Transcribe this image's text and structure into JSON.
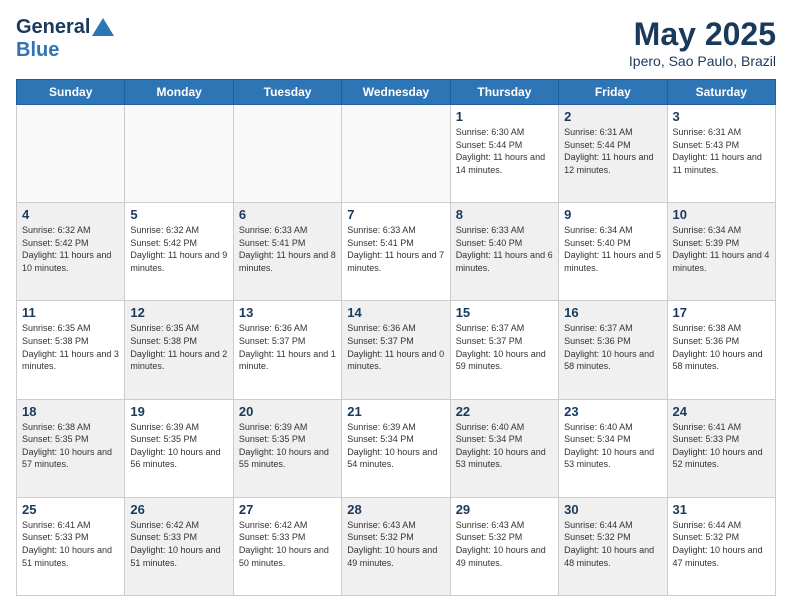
{
  "header": {
    "logo_line1": "General",
    "logo_line2": "Blue",
    "month": "May 2025",
    "location": "Ipero, Sao Paulo, Brazil"
  },
  "days_of_week": [
    "Sunday",
    "Monday",
    "Tuesday",
    "Wednesday",
    "Thursday",
    "Friday",
    "Saturday"
  ],
  "weeks": [
    [
      {
        "day": "",
        "empty": true
      },
      {
        "day": "",
        "empty": true
      },
      {
        "day": "",
        "empty": true
      },
      {
        "day": "",
        "empty": true
      },
      {
        "day": "1",
        "sunrise": "6:30 AM",
        "sunset": "5:44 PM",
        "daylight": "11 hours and 14 minutes."
      },
      {
        "day": "2",
        "sunrise": "6:31 AM",
        "sunset": "5:44 PM",
        "daylight": "11 hours and 12 minutes."
      },
      {
        "day": "3",
        "sunrise": "6:31 AM",
        "sunset": "5:43 PM",
        "daylight": "11 hours and 11 minutes."
      }
    ],
    [
      {
        "day": "4",
        "sunrise": "6:32 AM",
        "sunset": "5:42 PM",
        "daylight": "11 hours and 10 minutes."
      },
      {
        "day": "5",
        "sunrise": "6:32 AM",
        "sunset": "5:42 PM",
        "daylight": "11 hours and 9 minutes."
      },
      {
        "day": "6",
        "sunrise": "6:33 AM",
        "sunset": "5:41 PM",
        "daylight": "11 hours and 8 minutes."
      },
      {
        "day": "7",
        "sunrise": "6:33 AM",
        "sunset": "5:41 PM",
        "daylight": "11 hours and 7 minutes."
      },
      {
        "day": "8",
        "sunrise": "6:33 AM",
        "sunset": "5:40 PM",
        "daylight": "11 hours and 6 minutes."
      },
      {
        "day": "9",
        "sunrise": "6:34 AM",
        "sunset": "5:40 PM",
        "daylight": "11 hours and 5 minutes."
      },
      {
        "day": "10",
        "sunrise": "6:34 AM",
        "sunset": "5:39 PM",
        "daylight": "11 hours and 4 minutes."
      }
    ],
    [
      {
        "day": "11",
        "sunrise": "6:35 AM",
        "sunset": "5:38 PM",
        "daylight": "11 hours and 3 minutes."
      },
      {
        "day": "12",
        "sunrise": "6:35 AM",
        "sunset": "5:38 PM",
        "daylight": "11 hours and 2 minutes."
      },
      {
        "day": "13",
        "sunrise": "6:36 AM",
        "sunset": "5:37 PM",
        "daylight": "11 hours and 1 minute."
      },
      {
        "day": "14",
        "sunrise": "6:36 AM",
        "sunset": "5:37 PM",
        "daylight": "11 hours and 0 minutes."
      },
      {
        "day": "15",
        "sunrise": "6:37 AM",
        "sunset": "5:37 PM",
        "daylight": "10 hours and 59 minutes."
      },
      {
        "day": "16",
        "sunrise": "6:37 AM",
        "sunset": "5:36 PM",
        "daylight": "10 hours and 58 minutes."
      },
      {
        "day": "17",
        "sunrise": "6:38 AM",
        "sunset": "5:36 PM",
        "daylight": "10 hours and 58 minutes."
      }
    ],
    [
      {
        "day": "18",
        "sunrise": "6:38 AM",
        "sunset": "5:35 PM",
        "daylight": "10 hours and 57 minutes."
      },
      {
        "day": "19",
        "sunrise": "6:39 AM",
        "sunset": "5:35 PM",
        "daylight": "10 hours and 56 minutes."
      },
      {
        "day": "20",
        "sunrise": "6:39 AM",
        "sunset": "5:35 PM",
        "daylight": "10 hours and 55 minutes."
      },
      {
        "day": "21",
        "sunrise": "6:39 AM",
        "sunset": "5:34 PM",
        "daylight": "10 hours and 54 minutes."
      },
      {
        "day": "22",
        "sunrise": "6:40 AM",
        "sunset": "5:34 PM",
        "daylight": "10 hours and 53 minutes."
      },
      {
        "day": "23",
        "sunrise": "6:40 AM",
        "sunset": "5:34 PM",
        "daylight": "10 hours and 53 minutes."
      },
      {
        "day": "24",
        "sunrise": "6:41 AM",
        "sunset": "5:33 PM",
        "daylight": "10 hours and 52 minutes."
      }
    ],
    [
      {
        "day": "25",
        "sunrise": "6:41 AM",
        "sunset": "5:33 PM",
        "daylight": "10 hours and 51 minutes."
      },
      {
        "day": "26",
        "sunrise": "6:42 AM",
        "sunset": "5:33 PM",
        "daylight": "10 hours and 51 minutes."
      },
      {
        "day": "27",
        "sunrise": "6:42 AM",
        "sunset": "5:33 PM",
        "daylight": "10 hours and 50 minutes."
      },
      {
        "day": "28",
        "sunrise": "6:43 AM",
        "sunset": "5:32 PM",
        "daylight": "10 hours and 49 minutes."
      },
      {
        "day": "29",
        "sunrise": "6:43 AM",
        "sunset": "5:32 PM",
        "daylight": "10 hours and 49 minutes."
      },
      {
        "day": "30",
        "sunrise": "6:44 AM",
        "sunset": "5:32 PM",
        "daylight": "10 hours and 48 minutes."
      },
      {
        "day": "31",
        "sunrise": "6:44 AM",
        "sunset": "5:32 PM",
        "daylight": "10 hours and 47 minutes."
      }
    ]
  ]
}
